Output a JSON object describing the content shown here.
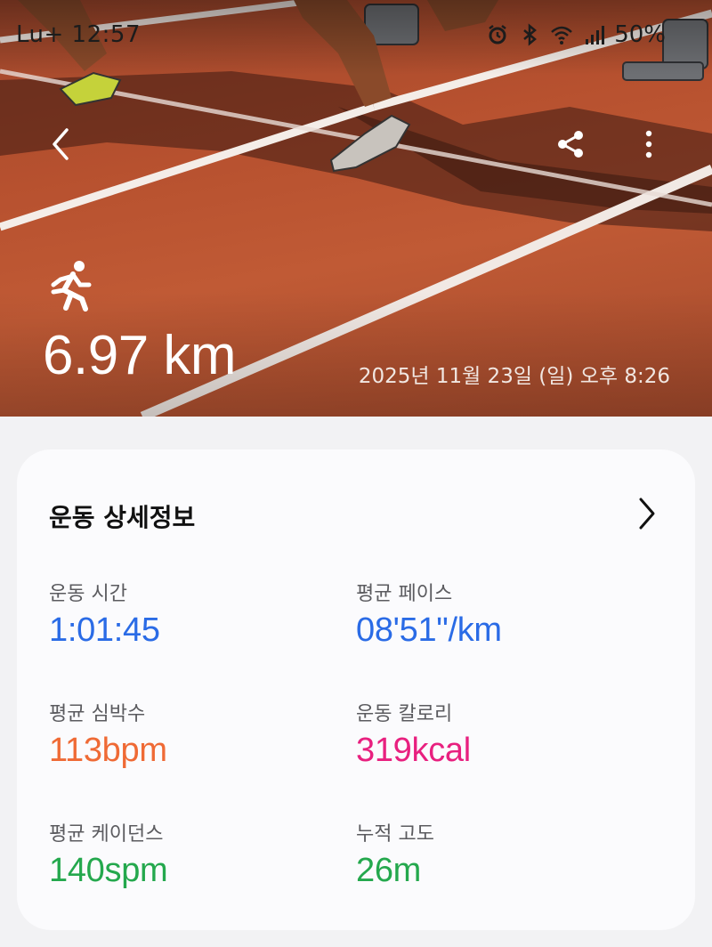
{
  "status_bar": {
    "carrier": "Lu+ 12:57",
    "battery": "50%"
  },
  "hero": {
    "distance": "6.97 km",
    "datetime": "2025년 11월 23일 (일) 오후 8:26"
  },
  "icons": {
    "back": "chevron-left-icon",
    "share": "share-icon",
    "more": "more-vertical-icon",
    "activity": "running-icon",
    "details": "chevron-right-icon"
  },
  "details": {
    "title": "운동 상세정보",
    "stats": [
      {
        "label": "운동 시간",
        "value": "1:01:45",
        "color": "#2a6be6"
      },
      {
        "label": "평균 페이스",
        "value": "08'51\"/km",
        "color": "#2a6be6"
      },
      {
        "label": "평균 심박수",
        "value": "113bpm",
        "color": "#ef6a35"
      },
      {
        "label": "운동 칼로리",
        "value": "319kcal",
        "color": "#e8207f"
      },
      {
        "label": "평균 케이던스",
        "value": "140spm",
        "color": "#24a84d"
      },
      {
        "label": "누적 고도",
        "value": "26m",
        "color": "#24a84d"
      }
    ]
  }
}
